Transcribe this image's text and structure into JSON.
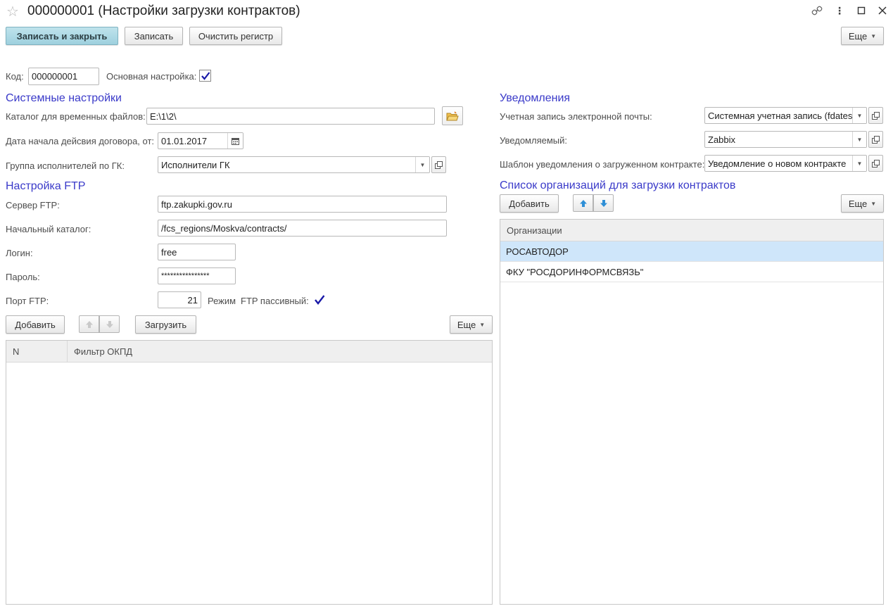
{
  "window": {
    "title": "000000001 (Настройки загрузки контрактов)"
  },
  "toolbar": {
    "save_close": "Записать и закрыть",
    "save": "Записать",
    "clear_register": "Очистить регистр",
    "more": "Еще"
  },
  "header_fields": {
    "code_label": "Код:",
    "code_value": "000000001",
    "main_setting_label": "Основная настройка:",
    "main_setting_checked": true
  },
  "system": {
    "title": "Системные настройки",
    "temp_dir_label": "Каталог для временных файлов:",
    "temp_dir_value": "E:\\1\\2\\",
    "start_date_label": "Дата начала дейсвия договора, от:",
    "start_date_value": "01.01.2017",
    "group_label": "Группа исполнителей по ГК:",
    "group_value": "Исполнители ГК"
  },
  "ftp": {
    "title": "Настройка FTP",
    "server_label": "Сервер FTP:",
    "server_value": "ftp.zakupki.gov.ru",
    "dir_label": "Начальный каталог:",
    "dir_value": "/fcs_regions/Moskva/contracts/",
    "login_label": "Логин:",
    "login_value": "free",
    "password_label": "Пароль:",
    "password_value": "****************",
    "port_label": "Порт FTP:",
    "port_value": "21",
    "mode_label": "Режим",
    "passive_label": "FTP пассивный:",
    "passive_checked": true
  },
  "okpd": {
    "add": "Добавить",
    "load": "Загрузить",
    "more": "Еще",
    "columns": [
      "N",
      "Фильтр ОКПД"
    ],
    "rows": []
  },
  "notifications": {
    "title": "Уведомления",
    "email_label": "Учетная запись электронной почты:",
    "email_value": "Системная учетная запись (fdates",
    "recipient_label": "Уведомляемый:",
    "recipient_value": "Zabbix",
    "template_label": "Шаблон уведомления о загруженном контракте:",
    "template_value": "Уведомление о новом контракте"
  },
  "orgs": {
    "title": "Список организаций для загрузки контрактов",
    "add": "Добавить",
    "more": "Еще",
    "column": "Организации",
    "rows": [
      "РОСАВТОДОР",
      "ФКУ \"РОСДОРИНФОРМСВЯЗЬ\""
    ],
    "selected_index": 0
  },
  "icons": {
    "star": "star-icon",
    "link": "link-icon",
    "menu": "kebab-menu-icon",
    "maximize": "maximize-icon",
    "close": "close-icon",
    "folder": "folder-open-icon",
    "calendar": "calendar-icon",
    "open": "open-form-icon",
    "up": "arrow-up-icon",
    "down": "arrow-down-icon"
  },
  "colors": {
    "primary_button": "#9ed0de",
    "section_title": "#3a3ac9",
    "selected_row": "#cfe6fa",
    "checkmark": "#1a1aa8",
    "arrow_active": "#2e8fd6"
  }
}
